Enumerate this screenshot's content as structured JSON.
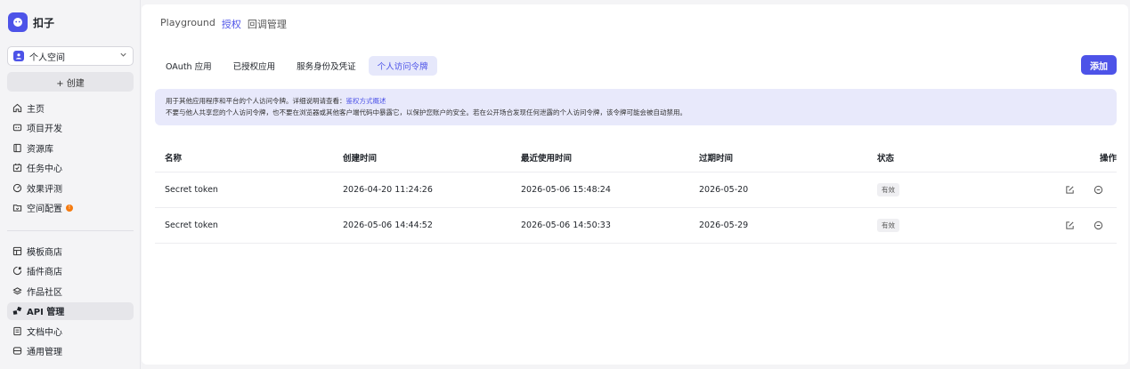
{
  "brand": {
    "name": "扣子"
  },
  "space": {
    "label": "个人空间"
  },
  "create_label": "+ 创建",
  "nav_main": [
    {
      "label": "主页",
      "icon": "home-icon"
    },
    {
      "label": "项目开发",
      "icon": "project-icon"
    },
    {
      "label": "资源库",
      "icon": "library-icon"
    },
    {
      "label": "任务中心",
      "icon": "task-icon"
    },
    {
      "label": "效果评测",
      "icon": "evaluate-icon"
    },
    {
      "label": "空间配置",
      "icon": "space-config-icon",
      "dot": true
    }
  ],
  "nav_secondary": [
    {
      "label": "模板商店",
      "icon": "template-icon"
    },
    {
      "label": "插件商店",
      "icon": "plugin-icon"
    },
    {
      "label": "作品社区",
      "icon": "community-icon"
    },
    {
      "label": "API 管理",
      "icon": "api-icon",
      "active": true
    },
    {
      "label": "文档中心",
      "icon": "doc-icon"
    },
    {
      "label": "通用管理",
      "icon": "general-icon"
    }
  ],
  "breadcrumb": [
    "Playground",
    "授权",
    "回调管理"
  ],
  "tabs": [
    "OAuth 应用",
    "已授权应用",
    "服务身份及凭证",
    "个人访问令牌"
  ],
  "active_tab": 3,
  "add_label": "添加",
  "notice": {
    "line1_prefix": "用于其他应用程序和平台的个人访问令牌。详细说明请查看：",
    "line1_link": "鉴权方式概述",
    "line2": "不要与他人共享您的个人访问令牌，也不要在浏览器或其他客户端代码中暴露它，以保护您账户的安全。若在公开场合发现任何泄露的个人访问令牌，该令牌可能会被自动禁用。"
  },
  "table": {
    "columns": [
      "名称",
      "创建时间",
      "最近使用时间",
      "过期时间",
      "状态",
      "操作"
    ],
    "rows": [
      {
        "name": "Secret token",
        "created": "2026-04-20 11:24:26",
        "last_used": "2026-05-06 15:48:24",
        "expires": "2026-05-20",
        "status": "有效"
      },
      {
        "name": "Secret token",
        "created": "2026-05-06 14:44:52",
        "last_used": "2026-05-06 14:50:33",
        "expires": "2026-05-29",
        "status": "有效"
      }
    ]
  },
  "colors": {
    "accent": "#4d53e8",
    "notice_bg": "#e8e9fb",
    "dot": "#f57a0f"
  }
}
